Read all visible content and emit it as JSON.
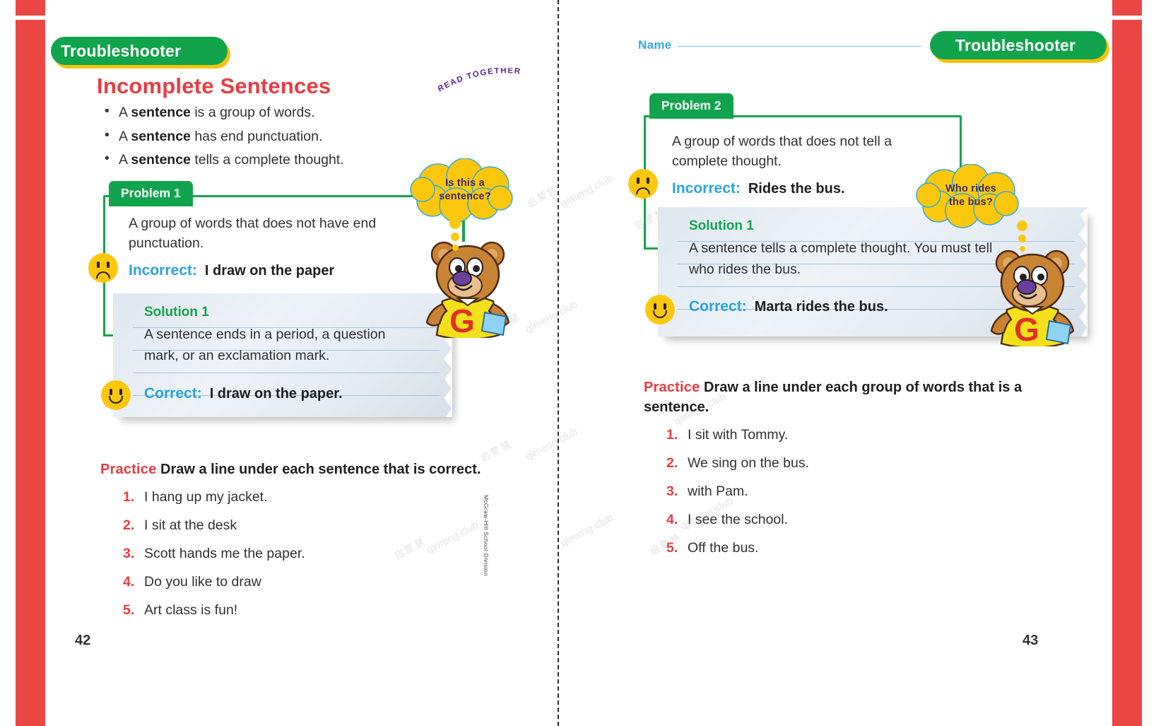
{
  "colors": {
    "red_bar": "#ea4644",
    "green": "#12a44c",
    "banner_shadow_yellow": "#f6c40f",
    "title_red": "#ea3b42",
    "label_blue": "#29a3dc",
    "bubble_yellow": "#fdc70e",
    "bubble_text": "#3b2a63",
    "name_blue": "#36a9e1",
    "solution_card": "#e3eaf2",
    "body_text": "#2f3133"
  },
  "left_page": {
    "banner_label": "Troubleshooter",
    "lesson_title": "Incomplete Sentences",
    "read_together": "READ TOGETHER",
    "rules": [
      {
        "pre": "A ",
        "bold": "sentence",
        "post": " is a group of words."
      },
      {
        "pre": "A ",
        "bold": "sentence",
        "post": " has end punctuation."
      },
      {
        "pre": "A ",
        "bold": "sentence",
        "post": " tells a complete thought."
      }
    ],
    "problem": {
      "tab_label": "Problem 1",
      "statement": "A group of words that does not have end punctuation.",
      "incorrect_label": "Incorrect:",
      "incorrect_text": "I draw on the paper"
    },
    "bubble": {
      "line1": "Is this a",
      "line2": "sentence?"
    },
    "solution": {
      "title": "Solution 1",
      "text": "A sentence ends in a period, a question mark, or an exclamation mark.",
      "correct_label": "Correct:",
      "correct_text": "I draw on the paper."
    },
    "practice": {
      "keyword": "Practice",
      "instruction": "Draw a line under each sentence that is correct.",
      "items": [
        {
          "num": "1.",
          "text": "I hang up my jacket."
        },
        {
          "num": "2.",
          "text": "I sit at the desk"
        },
        {
          "num": "3.",
          "text": "Scott hands me the paper."
        },
        {
          "num": "4.",
          "text": "Do you like to draw"
        },
        {
          "num": "5.",
          "text": "Art class is fun!"
        }
      ]
    },
    "page_number": "42"
  },
  "right_page": {
    "name_label": "Name",
    "banner_label": "Troubleshooter",
    "problem": {
      "tab_label": "Problem 2",
      "statement": "A group of words that does not tell a complete thought.",
      "incorrect_label": "Incorrect:",
      "incorrect_text": "Rides the bus."
    },
    "bubble": {
      "line1": "Who rides",
      "line2": "the bus?"
    },
    "solution": {
      "title": "Solution 1",
      "text": "A sentence tells a complete thought. You must tell who rides the bus.",
      "correct_label": "Correct:",
      "correct_text": "Marta rides the bus."
    },
    "practice": {
      "keyword": "Practice",
      "instruction": "Draw a line under each group of words that is a sentence.",
      "items": [
        {
          "num": "1.",
          "text": "I sit with Tommy."
        },
        {
          "num": "2.",
          "text": "We sing on the bus."
        },
        {
          "num": "3.",
          "text": "with Pam."
        },
        {
          "num": "4.",
          "text": "I see the school."
        },
        {
          "num": "5.",
          "text": "Off the bus."
        }
      ]
    },
    "page_number": "43"
  },
  "credit": "McGraw-Hill School Division",
  "watermarks": {
    "latin": "qimeng.club",
    "cjk": "启蒙慧"
  }
}
